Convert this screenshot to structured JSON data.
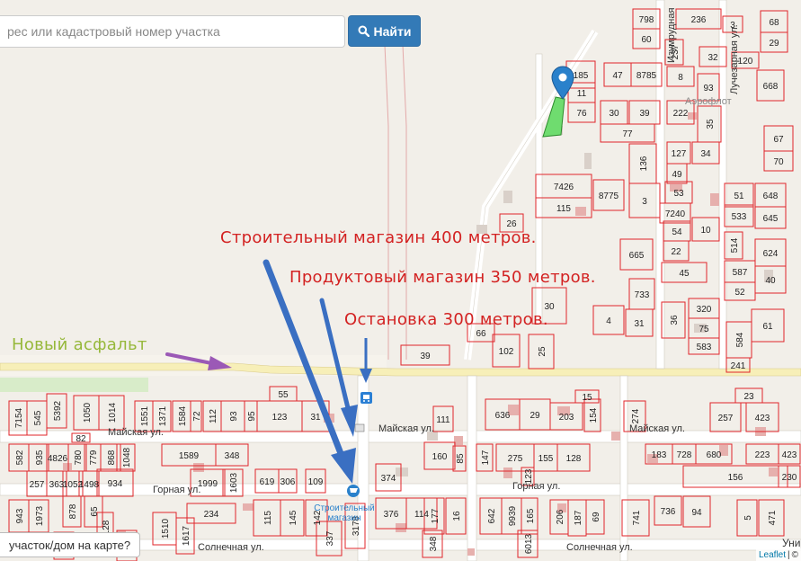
{
  "search": {
    "placeholder": "рес или кадастровый номер участка",
    "button_label": "Найти"
  },
  "annotations": {
    "hardware_store": "Строительный магазин 400 метров.",
    "grocery_store": "Продуктовый магазин 350 метров.",
    "bus_stop": "Остановка 300 метров.",
    "new_asphalt": "Новый асфальт"
  },
  "streets": [
    {
      "name": "Майская ул."
    },
    {
      "name": "Майская ул."
    },
    {
      "name": "Майская ул."
    },
    {
      "name": "Горная ул."
    },
    {
      "name": "Горная ул."
    },
    {
      "name": "Солнечная ул."
    },
    {
      "name": "Солнечная ул."
    },
    {
      "name": "Изумрудная"
    },
    {
      "name": "Лучезарная ул."
    }
  ],
  "pois": {
    "store_label": "Строительный магазин",
    "area_label": "Аэрофлот",
    "cut_label": "Уни"
  },
  "bottom_box": "участок/дом на карте?",
  "attribution": {
    "leaflet": "Leaflet",
    "sep": "|",
    "copy": "©"
  },
  "colors": {
    "parcel_border": "#e0262a",
    "selected_parcel": "#6fdc6f",
    "marker": "#2a81cb",
    "arrow": "#3a6fc2",
    "asphalt_arrow": "#9b59b6",
    "annotation_red": "#d32222",
    "annotation_green": "#96b83a"
  },
  "parcels": [
    {
      "label": "798"
    },
    {
      "label": "60"
    },
    {
      "label": "236"
    },
    {
      "label": "3"
    },
    {
      "label": "68"
    },
    {
      "label": "29"
    },
    {
      "label": "237"
    },
    {
      "label": "32"
    },
    {
      "label": "120"
    },
    {
      "label": "47"
    },
    {
      "label": "8785"
    },
    {
      "label": "8"
    },
    {
      "label": "93"
    },
    {
      "label": "668"
    },
    {
      "label": "11"
    },
    {
      "label": "76"
    },
    {
      "label": "30"
    },
    {
      "label": "39"
    },
    {
      "label": "222"
    },
    {
      "label": "35"
    },
    {
      "label": "77"
    },
    {
      "label": "67"
    },
    {
      "label": "70"
    },
    {
      "label": "127"
    },
    {
      "label": "34"
    },
    {
      "label": "136"
    },
    {
      "label": "49"
    },
    {
      "label": "7426"
    },
    {
      "label": "53"
    },
    {
      "label": "51"
    },
    {
      "label": "648"
    },
    {
      "label": "115"
    },
    {
      "label": "8775"
    },
    {
      "label": "3"
    },
    {
      "label": "7240"
    },
    {
      "label": "533"
    },
    {
      "label": "645"
    },
    {
      "label": "26"
    },
    {
      "label": "54"
    },
    {
      "label": "10"
    },
    {
      "label": "514"
    },
    {
      "label": "624"
    },
    {
      "label": "22"
    },
    {
      "label": "665"
    },
    {
      "label": "45"
    },
    {
      "label": "587"
    },
    {
      "label": "40"
    },
    {
      "label": "52"
    },
    {
      "label": "733"
    },
    {
      "label": "30"
    },
    {
      "label": "4"
    },
    {
      "label": "31"
    },
    {
      "label": "36"
    },
    {
      "label": "320"
    },
    {
      "label": "75"
    },
    {
      "label": "583"
    },
    {
      "label": "61"
    },
    {
      "label": "584"
    },
    {
      "label": "39"
    },
    {
      "label": "102"
    },
    {
      "label": "25"
    },
    {
      "label": "241"
    },
    {
      "label": "66"
    },
    {
      "label": "1551"
    },
    {
      "label": "1371"
    },
    {
      "label": "1584"
    },
    {
      "label": "72"
    },
    {
      "label": "112"
    },
    {
      "label": "93"
    },
    {
      "label": "95"
    },
    {
      "label": "123"
    },
    {
      "label": "31"
    },
    {
      "label": "111"
    },
    {
      "label": "636"
    },
    {
      "label": "29"
    },
    {
      "label": "203"
    },
    {
      "label": "154"
    },
    {
      "label": "274"
    },
    {
      "label": "257"
    },
    {
      "label": "423"
    },
    {
      "label": "1589"
    },
    {
      "label": "348"
    },
    {
      "label": "160"
    },
    {
      "label": "85"
    },
    {
      "label": "147"
    },
    {
      "label": "275"
    },
    {
      "label": "155"
    },
    {
      "label": "128"
    },
    {
      "label": "183"
    },
    {
      "label": "728"
    },
    {
      "label": "680"
    },
    {
      "label": "223"
    },
    {
      "label": "423"
    },
    {
      "label": "1999"
    },
    {
      "label": "1603"
    },
    {
      "label": "619"
    },
    {
      "label": "306"
    },
    {
      "label": "109"
    },
    {
      "label": "374"
    },
    {
      "label": "934"
    },
    {
      "label": "156"
    },
    {
      "label": "230"
    },
    {
      "label": "234"
    },
    {
      "label": "115"
    },
    {
      "label": "145"
    },
    {
      "label": "142"
    },
    {
      "label": "376"
    },
    {
      "label": "114"
    },
    {
      "label": "177"
    },
    {
      "label": "16"
    },
    {
      "label": "642"
    },
    {
      "label": "9939"
    },
    {
      "label": "165"
    },
    {
      "label": "206"
    },
    {
      "label": "187"
    },
    {
      "label": "69"
    },
    {
      "label": "741"
    },
    {
      "label": "736"
    },
    {
      "label": "94"
    },
    {
      "label": "5"
    },
    {
      "label": "471"
    },
    {
      "label": "137"
    },
    {
      "label": "3178"
    },
    {
      "label": "348"
    },
    {
      "label": "6013"
    },
    {
      "label": "337"
    },
    {
      "label": "128"
    },
    {
      "label": "65"
    },
    {
      "label": "878"
    },
    {
      "label": "248"
    },
    {
      "label": "1510"
    },
    {
      "label": "1617"
    },
    {
      "label": "5392"
    },
    {
      "label": "1050"
    },
    {
      "label": "1014"
    },
    {
      "label": "545"
    },
    {
      "label": "7154"
    },
    {
      "label": "582"
    },
    {
      "label": "935"
    },
    {
      "label": "4826"
    },
    {
      "label": "780"
    },
    {
      "label": "779"
    },
    {
      "label": "868"
    },
    {
      "label": "1048"
    },
    {
      "label": "257"
    },
    {
      "label": "363"
    },
    {
      "label": "1052"
    },
    {
      "label": "1498"
    },
    {
      "label": "943"
    },
    {
      "label": "1973"
    },
    {
      "label": "123"
    },
    {
      "label": "185"
    },
    {
      "label": "55"
    },
    {
      "label": "15"
    },
    {
      "label": "23"
    },
    {
      "label": "82"
    }
  ]
}
